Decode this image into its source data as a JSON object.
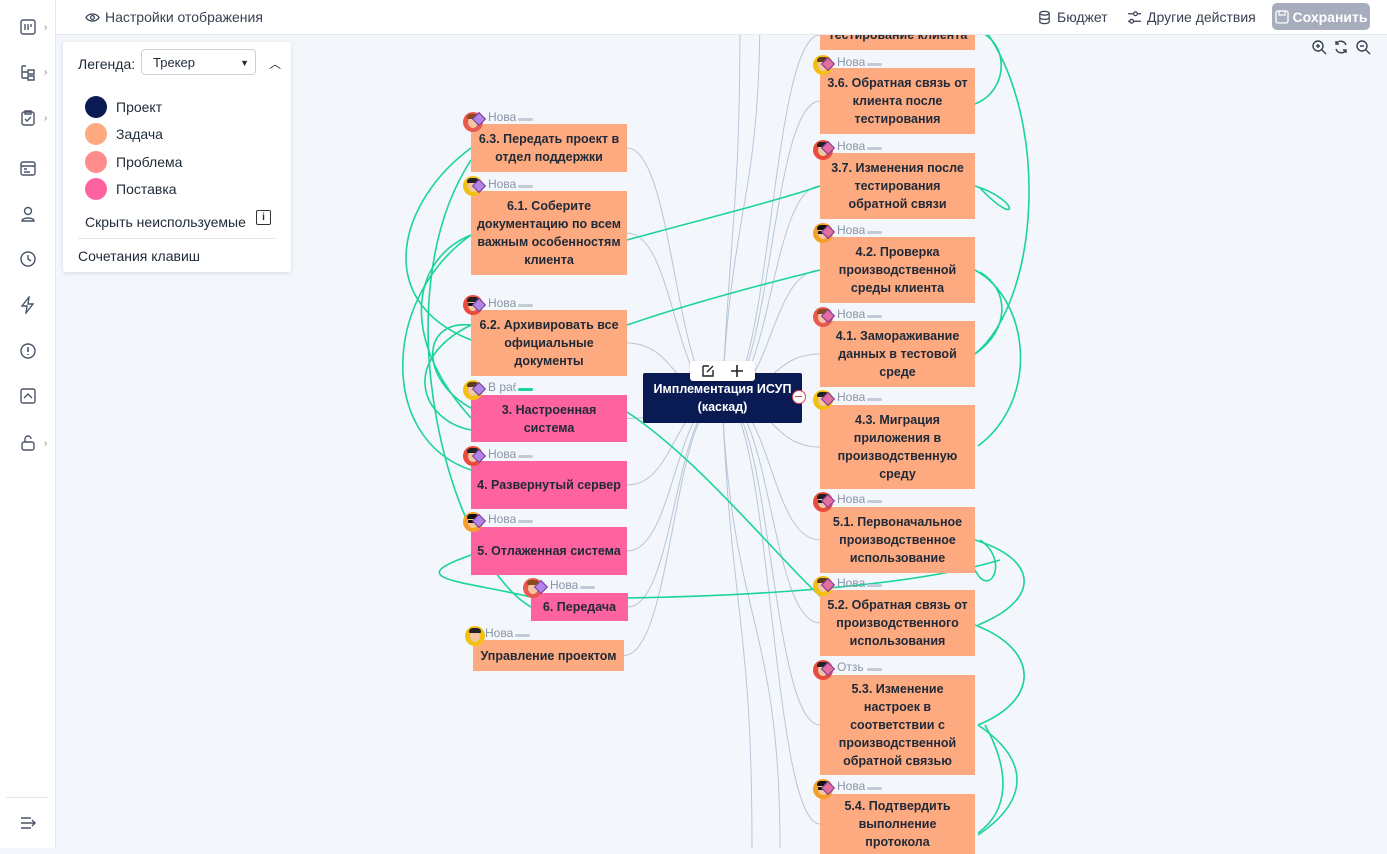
{
  "topbar": {
    "display_settings": "Настройки отображения",
    "budget": "Бюджет",
    "other_actions": "Другие действия",
    "save": "Сохранить"
  },
  "legend": {
    "label": "Легенда:",
    "selected": "Трекер",
    "items": [
      {
        "label": "Проект",
        "color": "#0a1a52"
      },
      {
        "label": "Задача",
        "color": "#fdaa80"
      },
      {
        "label": "Проблема",
        "color": "#ff8c8c"
      },
      {
        "label": "Поставка",
        "color": "#fe639f"
      }
    ],
    "hide_unused": "Скрыть неиспользуемые",
    "info": "i",
    "shortcuts": "Сочетания клавиш"
  },
  "colors": {
    "project": "#0a1a52",
    "task": "#fdaa80",
    "delivery": "#fe639f",
    "link": "#1bd39b",
    "edge": "#b8c6d8"
  },
  "center_node": {
    "label": "Имплементация ИСУП (каскад)"
  },
  "nodes": [
    {
      "id": "n_top",
      "label": "Тестирование клиента",
      "type": "task",
      "status": ""
    },
    {
      "id": "n36",
      "label": "3.6. Обратная связь от клиента после тестирования",
      "type": "task",
      "status": "Нова"
    },
    {
      "id": "n37",
      "label": "3.7. Изменения после тестирования обратной связи",
      "type": "task",
      "status": "Нова"
    },
    {
      "id": "n42",
      "label": "4.2. Проверка производственной среды клиента",
      "type": "task",
      "status": "Нова"
    },
    {
      "id": "n41",
      "label": "4.1. Замораживание данных в тестовой среде",
      "type": "task",
      "status": "Нова"
    },
    {
      "id": "n43",
      "label": "4.3. Миграция приложения в производственную среду",
      "type": "task",
      "status": "Нова"
    },
    {
      "id": "n51",
      "label": "5.1. Первоначальное производственное использование",
      "type": "task",
      "status": "Нова"
    },
    {
      "id": "n52",
      "label": "5.2. Обратная связь от производственного использования",
      "type": "task",
      "status": "Нова"
    },
    {
      "id": "n53",
      "label": "5.3. Изменение настроек в соответствии с производственной обратной связью",
      "type": "task",
      "status": "Отзь"
    },
    {
      "id": "n54",
      "label": "5.4. Подтвердить выполнение протокола",
      "type": "task",
      "status": "Нова"
    },
    {
      "id": "n63",
      "label": "6.3. Передать проект в отдел поддержки",
      "type": "task",
      "status": "Нова"
    },
    {
      "id": "n61",
      "label": "6.1. Соберите документацию по всем важным особенностям клиента",
      "type": "task",
      "status": "Нова"
    },
    {
      "id": "n62",
      "label": "6.2. Архивировать все официальные документы",
      "type": "task",
      "status": "Нова"
    },
    {
      "id": "d3",
      "label": "3. Настроенная система",
      "type": "delivery",
      "status": "В раб"
    },
    {
      "id": "d4",
      "label": "4. Развернутый сервер",
      "type": "delivery",
      "status": "Нова"
    },
    {
      "id": "d5",
      "label": "5. Отлаженная система",
      "type": "delivery",
      "status": "Нова"
    },
    {
      "id": "d6",
      "label": "6. Передача",
      "type": "delivery",
      "status": "Нова"
    },
    {
      "id": "pm",
      "label": "Управление проектом",
      "type": "task",
      "status": "Нова"
    }
  ]
}
